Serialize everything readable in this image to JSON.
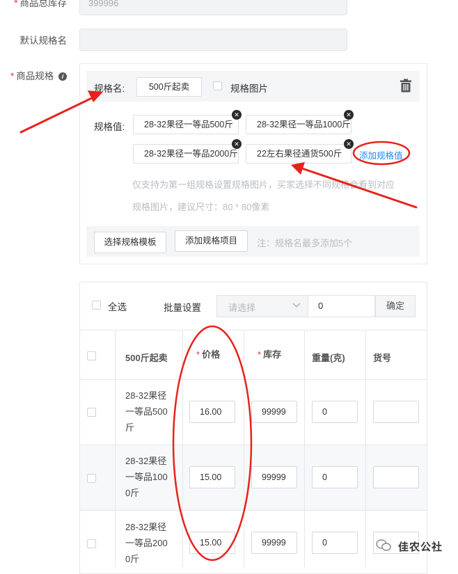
{
  "form": {
    "total_stock": {
      "label": "商品总库存",
      "value": "399996"
    },
    "default_spec_name": {
      "label": "默认规格名",
      "value": ""
    },
    "spec": {
      "label": "商品规格"
    }
  },
  "spec_group": {
    "name_label": "规格名:",
    "name_value": "500斤起卖",
    "image_checkbox_label": "规格图片",
    "values_label": "规格值:",
    "values": [
      "28-32果径一等品500斤",
      "28-32果径一等品1000斤",
      "28-32果径一等品2000斤",
      "22左右果径通货500斤"
    ],
    "add_value_link": "添加规格值",
    "hint_line1": "仅支持为第一组规格设置规格图片，买家选择不同规格会看到对应",
    "hint_line2": "规格图片，建议尺寸：80 * 80像素"
  },
  "spec_footer": {
    "choose_template": "选择规格模板",
    "add_item": "添加规格项目",
    "note": "注：规格名最多添加5个"
  },
  "batch": {
    "select_all": "全选",
    "batch_label": "批量设置",
    "select_placeholder": "请选择",
    "value": "0",
    "confirm": "确定"
  },
  "table": {
    "headers": [
      "500斤起卖",
      "价格",
      "库存",
      "重量(克)",
      "货号"
    ],
    "rows": [
      {
        "name_lines": [
          "28-32果径",
          "一等品500",
          "斤"
        ],
        "price": "16.00",
        "stock": "99999",
        "weight": "0",
        "sku": ""
      },
      {
        "name_lines": [
          "28-32果径",
          "一等品100",
          "0斤"
        ],
        "price": "15.00",
        "stock": "99999",
        "weight": "0",
        "sku": ""
      },
      {
        "name_lines": [
          "28-32果径",
          "一等品200",
          "0斤"
        ],
        "price": "15.00",
        "stock": "99999",
        "weight": "0",
        "sku": ""
      }
    ]
  },
  "watermark": "佳农公社",
  "colors": {
    "accent": "#1a8cff",
    "annotation": "#e8221c",
    "required": "#e33333"
  }
}
